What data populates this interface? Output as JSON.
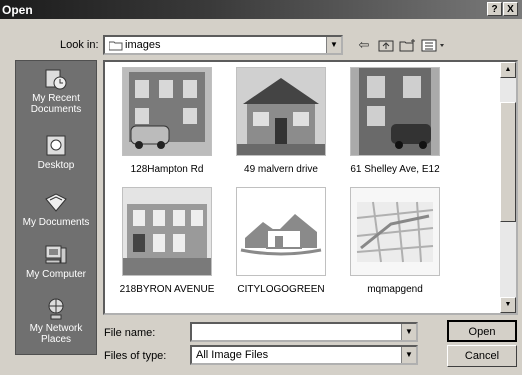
{
  "window": {
    "title": "Open",
    "help_label": "?",
    "close_label": "X"
  },
  "look_in": {
    "label": "Look in:",
    "value": "images"
  },
  "places": [
    {
      "label": "My Recent Documents"
    },
    {
      "label": "Desktop"
    },
    {
      "label": "My Documents"
    },
    {
      "label": "My Computer"
    },
    {
      "label": "My Network Places"
    }
  ],
  "files": [
    {
      "name": "128Hampton Rd"
    },
    {
      "name": "49 malvern drive"
    },
    {
      "name": "61 Shelley Ave, E12"
    },
    {
      "name": "218BYRON AVENUE"
    },
    {
      "name": "CITYLOGOGREEN"
    },
    {
      "name": "mqmapgend"
    }
  ],
  "file_name": {
    "label": "File name:",
    "value": ""
  },
  "file_type": {
    "label": "Files of type:",
    "value": "All Image Files"
  },
  "buttons": {
    "open": "Open",
    "cancel": "Cancel"
  },
  "icons": {
    "back": "back-arrow-icon",
    "up": "up-folder-icon",
    "new_folder": "new-folder-icon",
    "views": "views-menu-icon"
  }
}
